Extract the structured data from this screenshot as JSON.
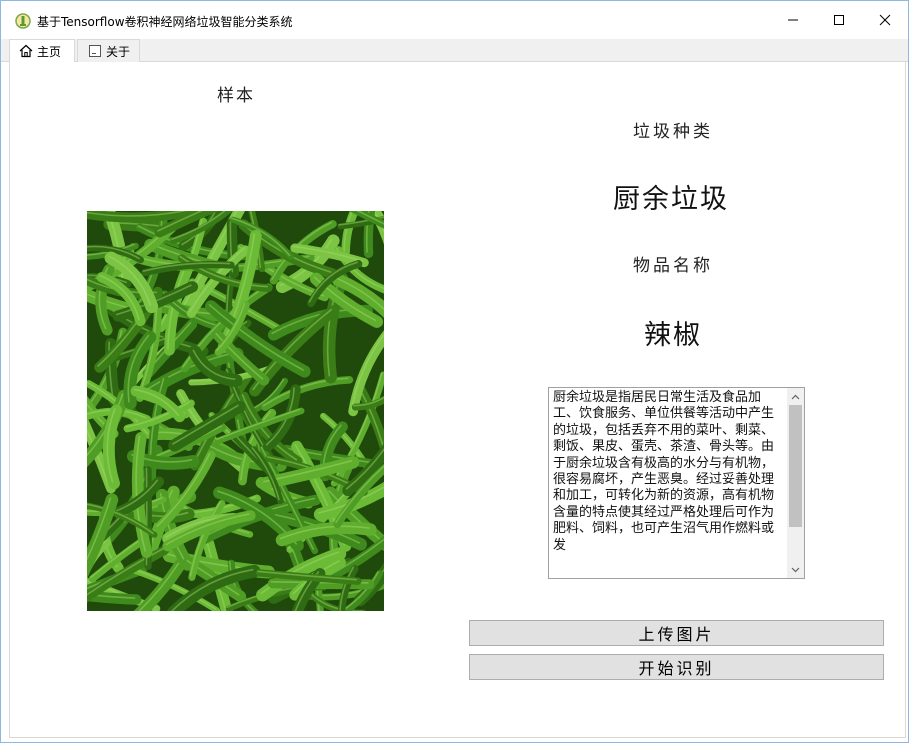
{
  "window": {
    "title": "基于Tensorflow卷积神经网络垃圾智能分类系统"
  },
  "tabs": [
    {
      "label": "主页",
      "icon": "home-icon",
      "selected": true
    },
    {
      "label": "关于",
      "icon": "document-icon",
      "selected": false
    }
  ],
  "main": {
    "sample_label": "样本",
    "sample_image": "green-chili-peppers-photo",
    "type_heading": "垃圾种类",
    "type_value": "厨余垃圾",
    "name_heading": "物品名称",
    "name_value": "辣椒",
    "description": "厨余垃圾是指居民日常生活及食品加工、饮食服务、单位供餐等活动中产生的垃圾，包括丢弃不用的菜叶、剩菜、剩饭、果皮、蛋壳、茶渣、骨头等。由于厨余垃圾含有极高的水分与有机物，很容易腐坏，产生恶臭。经过妥善处理和加工，可转化为新的资源，高有机物含量的特点使其经过严格处理后可作为肥料、饲料，也可产生沼气用作燃料或发",
    "upload_button": "上传图片",
    "recognize_button": "开始识别"
  },
  "colors": {
    "window_border": "#8fb8e0",
    "button_bg": "#e1e1e1",
    "pepper_green": "#3d7d1a"
  }
}
